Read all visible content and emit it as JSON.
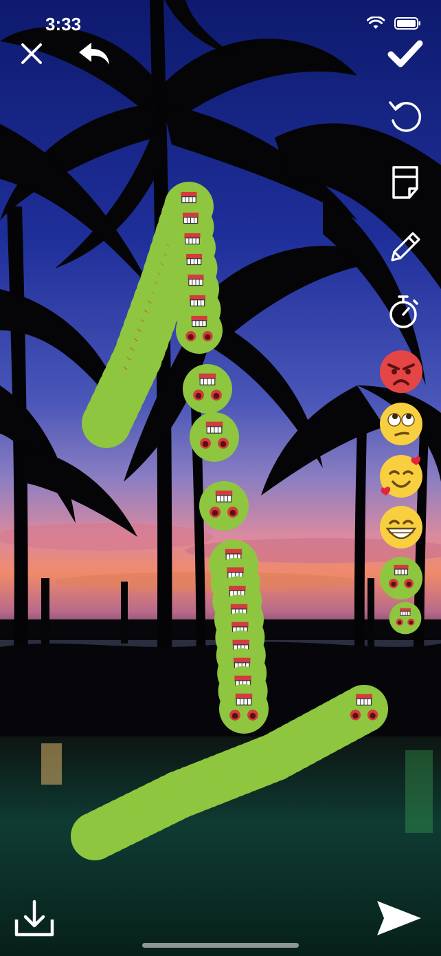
{
  "status_bar": {
    "time": "3:33"
  },
  "toolbar": {
    "close_icon": "close-icon",
    "undo_icon": "undo-arrow-icon",
    "confirm_icon": "checkmark-icon",
    "reset_icon": "rotate-ccw-icon",
    "sticker_icon": "sticker-icon",
    "draw_icon": "pencil-icon",
    "timer_icon": "stopwatch-icon",
    "download_icon": "download-icon",
    "send_icon": "send-icon"
  },
  "emoji_palette": [
    {
      "name": "angry-face",
      "color": "#e64545"
    },
    {
      "name": "eye-roll-face",
      "color": "#f8cf3e"
    },
    {
      "name": "smiling-face-with-hearts",
      "color": "#f8cf3e"
    },
    {
      "name": "grinning-face",
      "color": "#f8cf3e"
    },
    {
      "name": "zombie-face",
      "color": "#8ec63f"
    },
    {
      "name": "zombie-face-small",
      "color": "#8ec63f"
    }
  ],
  "drawing": {
    "brush_emoji": "zombie-face",
    "brush_color": "#8ec63f"
  }
}
